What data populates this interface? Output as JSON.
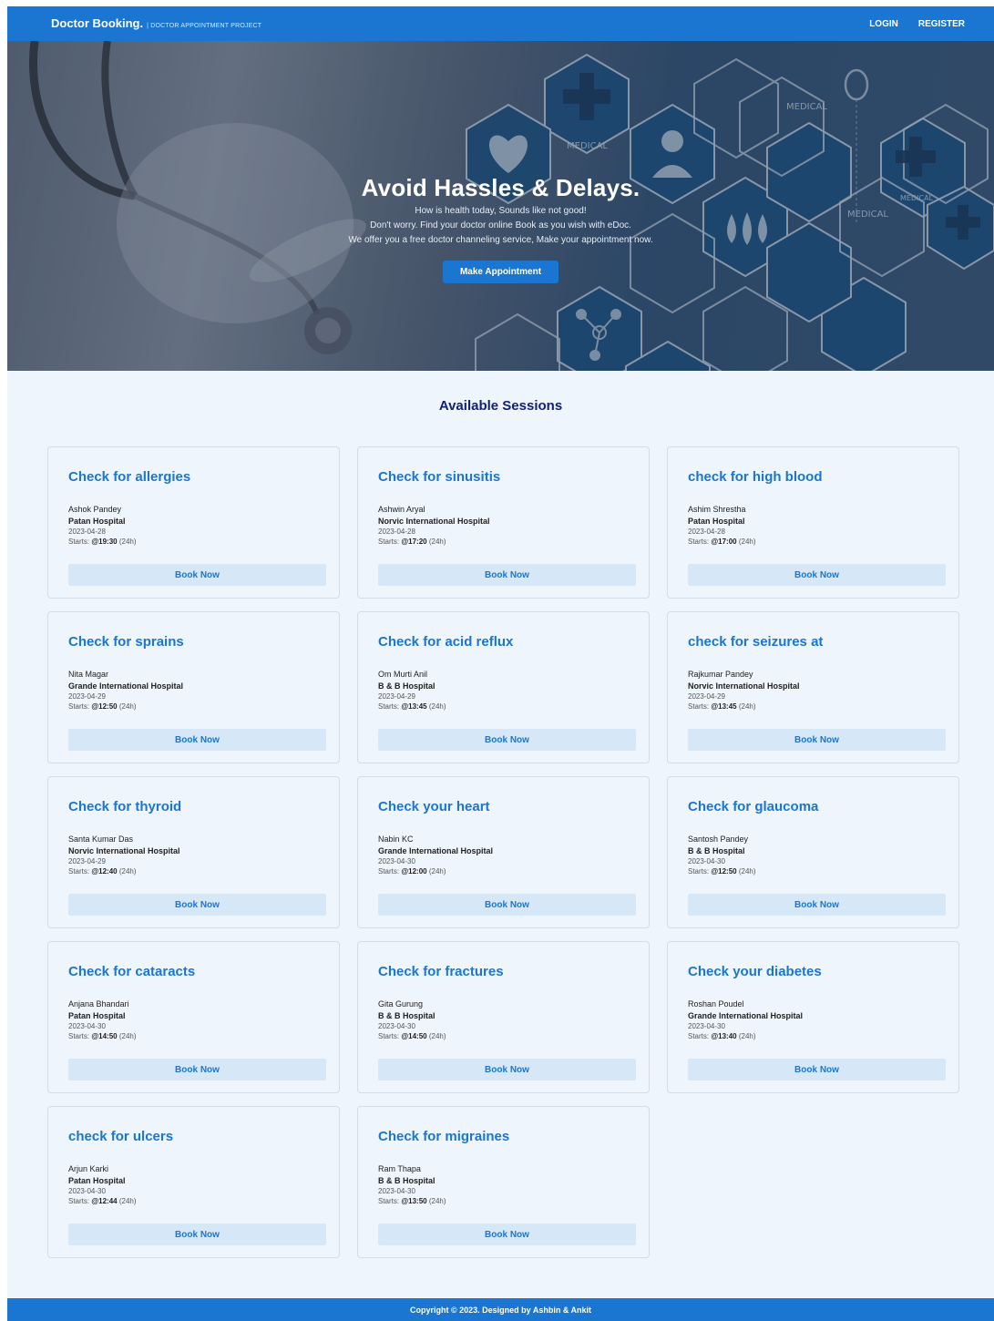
{
  "navbar": {
    "brand": "Doctor Booking.",
    "brand_sub": "| DOCTOR APPOINTMENT PROJECT",
    "login": "LOGIN",
    "register": "REGISTER"
  },
  "hero": {
    "title": "Avoid Hassles & Delays.",
    "line1": "How is health today, Sounds like not good!",
    "line2": "Don't worry. Find your doctor online Book as you wish with eDoc.",
    "line3": "We offer you a free doctor channeling service, Make your appointment now.",
    "button": "Make Appointment"
  },
  "sessions": {
    "title": "Available Sessions",
    "book_label": "Book Now",
    "starts_prefix": "Starts:",
    "starts_suffix": "(24h)",
    "items": [
      {
        "title": "Check for allergies",
        "doctor": "Ashok Pandey",
        "hospital": "Patan Hospital",
        "date": "2023-04-28",
        "time": "@19:30"
      },
      {
        "title": "Check for sinusitis",
        "doctor": "Ashwin Aryal",
        "hospital": "Norvic International Hospital",
        "date": "2023-04-28",
        "time": "@17:20"
      },
      {
        "title": "check for high blood",
        "doctor": "Ashim Shrestha",
        "hospital": "Patan Hospital",
        "date": "2023-04-28",
        "time": "@17:00"
      },
      {
        "title": "Check for sprains",
        "doctor": "Nita Magar",
        "hospital": "Grande International Hospital",
        "date": "2023-04-29",
        "time": "@12:50"
      },
      {
        "title": "Check for acid reflux",
        "doctor": "Om Murti Anil",
        "hospital": "B & B Hospital",
        "date": "2023-04-29",
        "time": "@13:45"
      },
      {
        "title": "check for seizures at",
        "doctor": "Rajkumar Pandey",
        "hospital": "Norvic International Hospital",
        "date": "2023-04-29",
        "time": "@13:45"
      },
      {
        "title": "Check for thyroid",
        "doctor": "Santa Kumar Das",
        "hospital": "Norvic International Hospital",
        "date": "2023-04-29",
        "time": "@12:40"
      },
      {
        "title": "Check your heart",
        "doctor": "Nabin KC",
        "hospital": "Grande International Hospital",
        "date": "2023-04-30",
        "time": "@12:00"
      },
      {
        "title": "Check for glaucoma",
        "doctor": "Santosh Pandey",
        "hospital": "B & B Hospital",
        "date": "2023-04-30",
        "time": "@12:50"
      },
      {
        "title": "Check for cataracts",
        "doctor": "Anjana Bhandari",
        "hospital": "Patan Hospital",
        "date": "2023-04-30",
        "time": "@14:50"
      },
      {
        "title": "Check for fractures",
        "doctor": "Gita Gurung",
        "hospital": "B & B Hospital",
        "date": "2023-04-30",
        "time": "@14:50"
      },
      {
        "title": "Check your diabetes",
        "doctor": "Roshan Poudel",
        "hospital": "Grande International Hospital",
        "date": "2023-04-30",
        "time": "@13:40"
      },
      {
        "title": "check for ulcers",
        "doctor": "Arjun Karki",
        "hospital": "Patan Hospital",
        "date": "2023-04-30",
        "time": "@12:44"
      },
      {
        "title": "Check for migraines",
        "doctor": "Ram Thapa",
        "hospital": "B & B Hospital",
        "date": "2023-04-30",
        "time": "@13:50"
      }
    ]
  },
  "hero_labels": {
    "medical": "MEDICAL"
  },
  "footer": {
    "copyright": "Copyright © 2023. Designed by Ashbin & Ankit"
  },
  "colors": {
    "primary": "#1a76d1",
    "heading": "#122178",
    "background": "#eef5fc",
    "book_button_bg": "#d6e7f8"
  }
}
